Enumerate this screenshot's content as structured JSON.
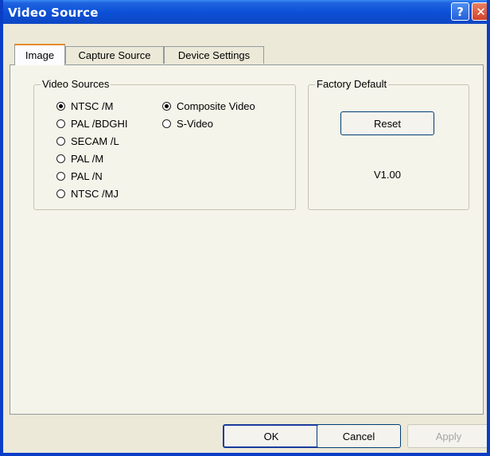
{
  "window": {
    "title": "Video Source"
  },
  "tabs": [
    {
      "label": "Image",
      "active": true
    },
    {
      "label": "Capture Source",
      "active": false
    },
    {
      "label": "Device Settings",
      "active": false
    }
  ],
  "video_sources": {
    "legend": "Video Sources",
    "standards": [
      {
        "label": "NTSC /M",
        "checked": true
      },
      {
        "label": "PAL /BDGHI",
        "checked": false
      },
      {
        "label": "SECAM /L",
        "checked": false
      },
      {
        "label": "PAL /M",
        "checked": false
      },
      {
        "label": "PAL /N",
        "checked": false
      },
      {
        "label": "NTSC /MJ",
        "checked": false
      }
    ],
    "inputs": [
      {
        "label": "Composite Video",
        "checked": true
      },
      {
        "label": "S-Video",
        "checked": false
      }
    ]
  },
  "factory_default": {
    "legend": "Factory Default",
    "reset_label": "Reset",
    "version": "V1.00"
  },
  "buttons": {
    "ok": "OK",
    "cancel": "Cancel",
    "apply": "Apply"
  },
  "colors": {
    "titlebar": "#0b4fd6",
    "tab_highlight": "#e68b2c",
    "dialog_bg": "#ece9d8"
  },
  "icons": {
    "help": "question-mark",
    "close": "x-mark"
  }
}
